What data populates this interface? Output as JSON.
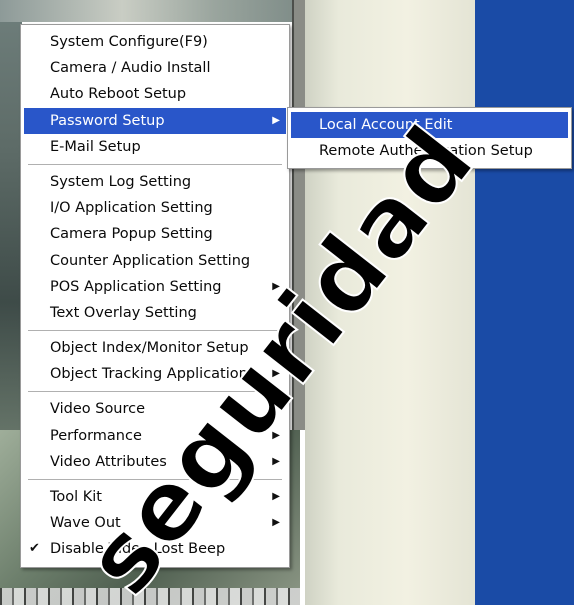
{
  "main_menu": {
    "groups": [
      [
        {
          "label": "System Configure(F9)"
        },
        {
          "label": "Camera / Audio Install"
        },
        {
          "label": "Auto Reboot Setup"
        },
        {
          "label": "Password Setup",
          "submenu": true,
          "selected": true
        },
        {
          "label": "E-Mail Setup"
        }
      ],
      [
        {
          "label": "System Log Setting"
        },
        {
          "label": "I/O Application Setting"
        },
        {
          "label": "Camera Popup Setting"
        },
        {
          "label": "Counter Application Setting"
        },
        {
          "label": "POS Application Setting",
          "submenu": true
        },
        {
          "label": "Text Overlay Setting"
        }
      ],
      [
        {
          "label": "Object Index/Monitor Setup"
        },
        {
          "label": "Object Tracking Application",
          "submenu": true
        }
      ],
      [
        {
          "label": "Video Source"
        },
        {
          "label": "Performance",
          "submenu": true
        },
        {
          "label": "Video Attributes",
          "submenu": true
        }
      ],
      [
        {
          "label": "Tool Kit",
          "submenu": true
        },
        {
          "label": "Wave Out",
          "submenu": true
        },
        {
          "label": "Disable Video Lost Beep",
          "checked": true
        }
      ]
    ]
  },
  "sub_menu": {
    "items": [
      {
        "label": "Local Account Edit",
        "selected": true
      },
      {
        "label": "Remote Authentication Setup"
      }
    ]
  },
  "watermark": {
    "text": "seguridad"
  },
  "glyphs": {
    "arrow": "▶",
    "check": "✔"
  },
  "colors": {
    "highlight": "#2956c9",
    "desktop_blue": "#1a4ba6"
  }
}
